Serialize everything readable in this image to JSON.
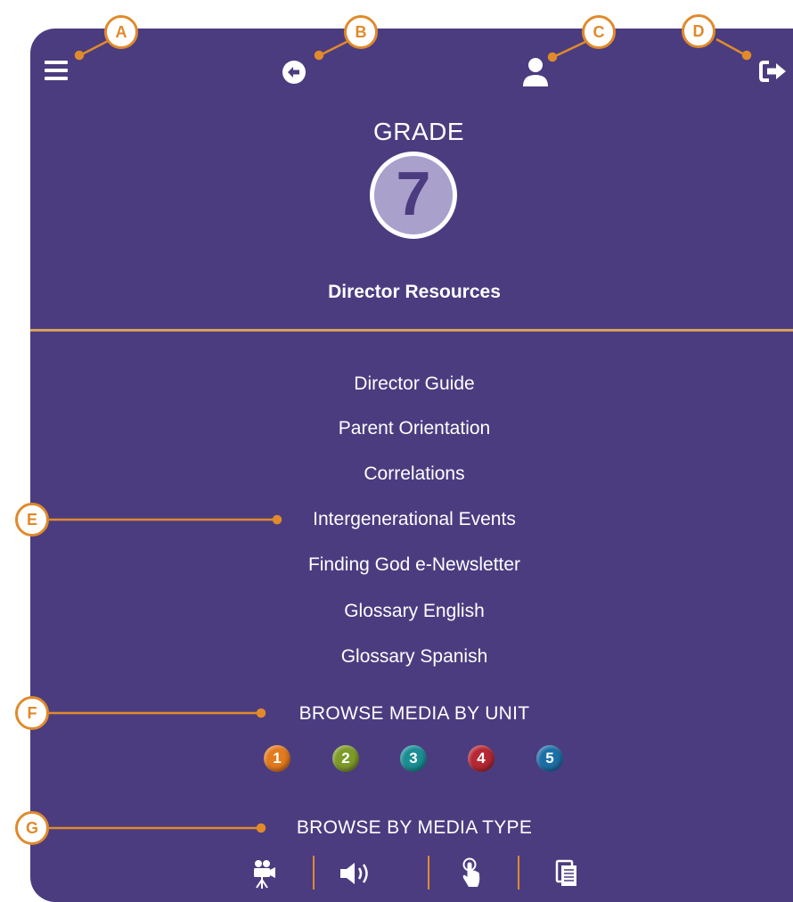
{
  "header": {
    "menu_icon": "hamburger-menu-icon",
    "back_icon": "back-arrow-circle-icon",
    "profile_icon": "user-icon",
    "logout_icon": "sign-out-icon"
  },
  "grade": {
    "label": "GRADE",
    "number": "7"
  },
  "section_title": "Director Resources",
  "resources": [
    "Director Guide",
    "Parent Orientation",
    "Correlations",
    "Intergenerational Events",
    "Finding God e-Newsletter",
    "Glossary English",
    "Glossary Spanish"
  ],
  "browse_units": {
    "heading": "BROWSE MEDIA BY UNIT",
    "units": [
      {
        "label": "1",
        "color": "#e27a1e"
      },
      {
        "label": "2",
        "color": "#7e9a2a"
      },
      {
        "label": "3",
        "color": "#1a8e94"
      },
      {
        "label": "4",
        "color": "#b52834"
      },
      {
        "label": "5",
        "color": "#1c6fa6"
      }
    ]
  },
  "browse_types": {
    "heading": "BROWSE BY MEDIA TYPE",
    "types": [
      "video-camera-icon",
      "audio-speaker-icon",
      "touch-interactive-icon",
      "document-icon"
    ]
  },
  "callouts": [
    "A",
    "B",
    "C",
    "D",
    "E",
    "F",
    "G"
  ],
  "colors": {
    "panel": "#4b3c80",
    "accent": "#e08a2b",
    "divider": "#d6a05d",
    "grade_circle": "#a9a0cc"
  }
}
